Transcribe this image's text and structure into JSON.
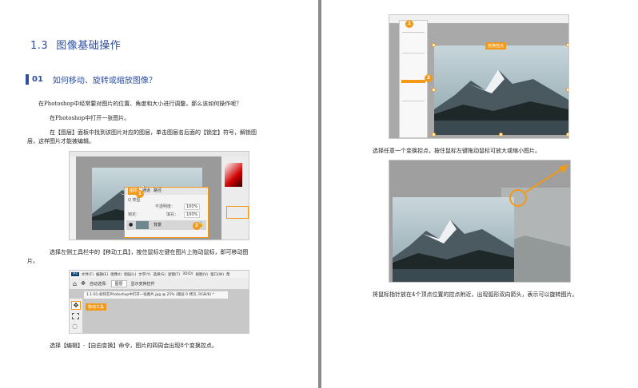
{
  "left": {
    "section": {
      "number": "1.3",
      "title": "图像基础操作"
    },
    "question": {
      "number": "01",
      "title": "如何移动、旋转或缩放图像？"
    },
    "paragraphs": [
      "在Photoshop中经常要对图片的位置、角度和大小进行调整，那么该如何操作呢？",
      "在Photoshop中打开一张图片。",
      "在【图层】面板中找到该图片对应的图层，单击图层名后面的【锁定】符号，解锁图",
      "层，这样图片才能被编辑。",
      "选择左侧工具栏中的【移动工具】，按住鼠标左键在图片上拖动鼠标，即可移动图",
      "片。",
      "选择【编辑】-【自由变换】命令，图片的四周会出现8个变换控点。"
    ],
    "layers_panel": {
      "tabs": [
        "图层",
        "通道",
        "路径"
      ],
      "opacity_label": "不透明度：",
      "opacity_value": "100%",
      "lock_label": "锁定：",
      "fill_label": "填充：",
      "fill_value": "100%",
      "layer_name": "背景",
      "kind_label": "Q 类型"
    },
    "move_tool_shot": {
      "menu": [
        "文件(F)",
        "编辑(E)",
        "图像(I)",
        "图层(L)",
        "文字(Y)",
        "选择(S)",
        "滤镜(T)",
        "3D(D)",
        "视图(V)",
        "窗口(W)",
        "帮"
      ],
      "auto_select": "自动选择:",
      "auto_select_value": "图层",
      "show_transform": "显示变换控件",
      "doc_tab": "1.1-01-如何在Photoshop中打开一张图片.jpg @ 25% (图层 0 拷贝, RGB/8) *",
      "tool_tag": "移动工具"
    },
    "callouts": [
      "1",
      "2"
    ]
  },
  "right": {
    "tag_transform": "变换控点",
    "callouts": [
      "1",
      "2"
    ],
    "caption1": "选择任意一个变换控点，按住鼠标左键拖动鼠标可放大或缩小图片。",
    "caption2": "将鼠标指针放在4个顶点位置的控点附近，出现弧形双向箭头，表示可以旋转图片。"
  },
  "colors": {
    "accent": "#2e4e9e",
    "callout": "#f29a18",
    "gutter": "#8a8a8a"
  }
}
